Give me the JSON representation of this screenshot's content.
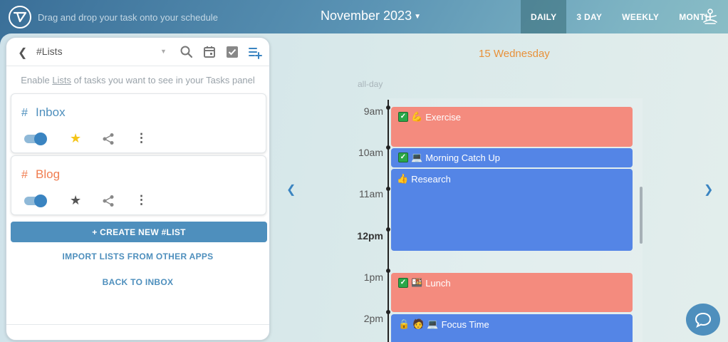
{
  "header": {
    "hint": "Drag and drop your task onto your schedule",
    "month": "November 2023",
    "tabs": [
      "DAILY",
      "3 DAY",
      "WEEKLY",
      "MONTH"
    ],
    "active_tab": "DAILY"
  },
  "panel": {
    "title": "#Lists",
    "hint_pre": "Enable ",
    "hint_link": "Lists",
    "hint_post": " of tasks you want to see in your Tasks panel",
    "lists": [
      {
        "hash": "#",
        "name": "Inbox",
        "color": "#4e8fbd",
        "starred": true
      },
      {
        "hash": "#",
        "name": "Blog",
        "color": "#f07d50",
        "starred": false
      }
    ],
    "create_label": "+ CREATE NEW #LIST",
    "import_label": "IMPORT LISTS FROM OTHER APPS",
    "back_label": "BACK TO INBOX"
  },
  "calendar": {
    "day_title": "15 Wednesday",
    "allday_label": "all-day",
    "times": [
      "9am",
      "10am",
      "11am",
      "12pm",
      "1pm",
      "2pm"
    ],
    "events": [
      {
        "title": "Exercise",
        "color": "red",
        "icons": [
          "check",
          "muscle"
        ]
      },
      {
        "title": "Morning Catch Up",
        "color": "blue",
        "icons": [
          "check",
          "laptop"
        ]
      },
      {
        "title": "Research",
        "color": "blue",
        "icons": [
          "thumbs-up"
        ]
      },
      {
        "title": "Lunch",
        "color": "red",
        "icons": [
          "check",
          "bento"
        ]
      },
      {
        "title": "Focus Time",
        "color": "blue",
        "icons": [
          "lock",
          "person",
          "laptop"
        ]
      }
    ]
  },
  "colors": {
    "accent": "#4e8fbd",
    "event_red": "#f48b7e",
    "event_blue": "#5485e6",
    "day_title": "#e8913a"
  }
}
